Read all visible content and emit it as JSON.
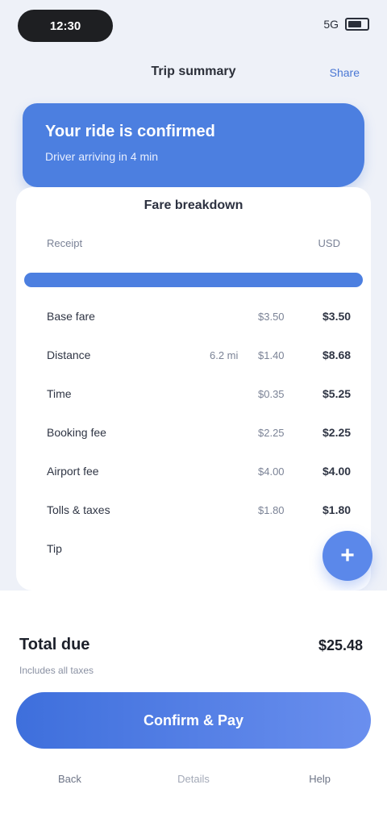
{
  "status": {
    "time": "12:30",
    "signal": "5G"
  },
  "header": {
    "title": "Trip summary",
    "action": "Share"
  },
  "banner": {
    "title": "Your ride is confirmed",
    "subtitle": "Driver arriving in 4 min"
  },
  "card": {
    "subtitle": "Fare breakdown",
    "meta_left": "Receipt",
    "meta_right": "USD"
  },
  "rows": [
    {
      "label": "Base fare",
      "col2": "",
      "col3": "$3.50",
      "col4": "$3.50"
    },
    {
      "label": "Distance",
      "col2": "6.2 mi",
      "col3": "$1.40",
      "col4": "$8.68"
    },
    {
      "label": "Time",
      "col2": "",
      "col3": "$0.35",
      "col4": "$5.25"
    },
    {
      "label": "Booking fee",
      "col2": "",
      "col3": "$2.25",
      "col4": "$2.25"
    },
    {
      "label": "Airport fee",
      "col2": "",
      "col3": "$4.00",
      "col4": "$4.00"
    },
    {
      "label": "Tolls & taxes",
      "col2": "",
      "col3": "$1.80",
      "col4": "$1.80"
    },
    {
      "label": "Tip",
      "col2": "",
      "col3": "",
      "col4": ""
    }
  ],
  "fab": {
    "label": "+"
  },
  "summary": {
    "total_label": "Total due",
    "total_value": "$25.48",
    "note": "Includes all taxes"
  },
  "cta": {
    "label": "Confirm & Pay"
  },
  "tabs": {
    "left": "Back",
    "center": "Details",
    "right": "Help"
  },
  "colors": {
    "accent": "#4c7fe0",
    "cta_start": "#3e6fdc",
    "cta_end": "#6a8fee"
  }
}
